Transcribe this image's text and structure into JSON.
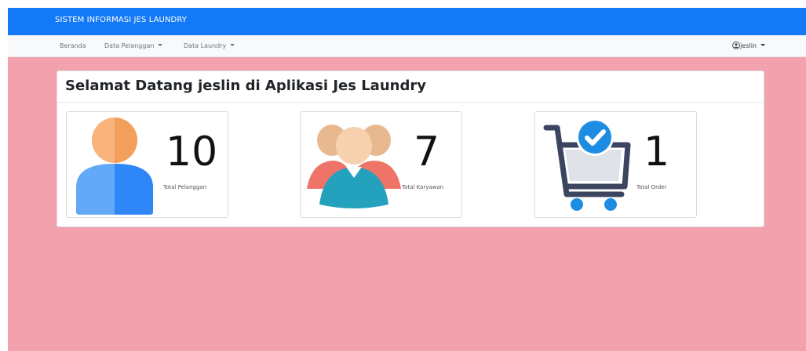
{
  "header": {
    "brand": "SISTEM INFORMASI JES LAUNDRY"
  },
  "nav": {
    "items": [
      {
        "label": "Beranda"
      },
      {
        "label": "Data Pelanggan"
      },
      {
        "label": "Data Laundry"
      }
    ],
    "user": "jeslin"
  },
  "main": {
    "title": "Selamat Datang jeslin di Aplikasi Jes Laundry",
    "cards": [
      {
        "value": "10",
        "label": "Total Pelanggan",
        "icon": "customer-icon"
      },
      {
        "value": "7",
        "label": "Total Karyawan",
        "icon": "employees-icon"
      },
      {
        "value": "1",
        "label": "Total Order",
        "icon": "shopping-cart-check-icon"
      }
    ]
  },
  "colors": {
    "topbar": "#1479f6",
    "page_background": "#f3a1ac",
    "navbar": "#f8f9fa"
  }
}
